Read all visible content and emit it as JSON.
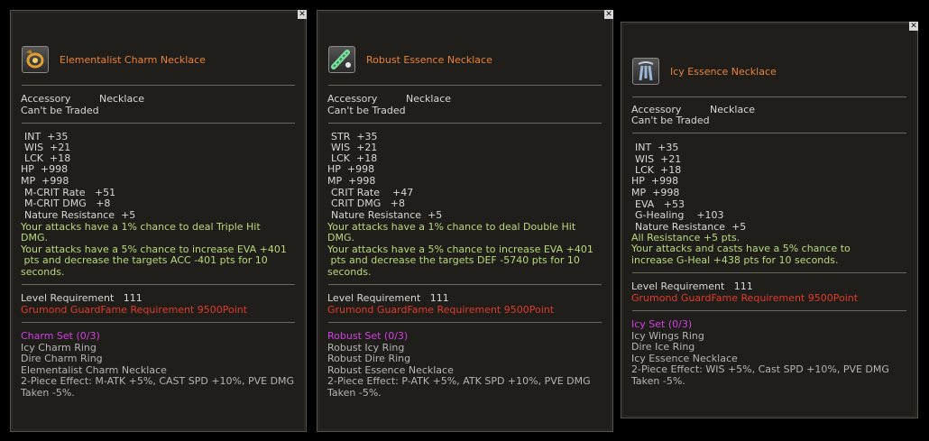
{
  "close_label": "✕",
  "panels": [
    {
      "title": "Elementalist Charm Necklace",
      "icon": "charm-necklace-icon",
      "type_label": "Accessory",
      "type_value": "Necklace",
      "trade": "Can't be Traded",
      "stats": [
        "INT  +35",
        "WIS  +21",
        "LCK  +18",
        "HP  +998",
        "MP  +998",
        "M-CRIT Rate   +51",
        "M-CRIT DMG   +8",
        "Nature Resistance  +5"
      ],
      "effects": [
        "Your attacks have a 1% chance to deal Triple Hit",
        "DMG.",
        "Your attacks have a 5% chance to increase EVA +401",
        " pts and decrease the targets ACC -401 pts for 10",
        "seconds."
      ],
      "level_req": "Level Requirement   111",
      "fame_req": "Grumond GuardFame Requirement 9500Point",
      "set_name": "Charm Set (0/3)",
      "set_items": [
        "Icy Charm Ring",
        "Dire Charm Ring",
        "Elementalist Charm Necklace",
        "2-Piece Effect: M-ATK +5%, CAST SPD +10%, PVE DMG",
        "Taken -5%."
      ]
    },
    {
      "title": "Robust Essence Necklace",
      "icon": "essence-necklace-icon",
      "type_label": "Accessory",
      "type_value": "Necklace",
      "trade": "Can't be Traded",
      "stats": [
        "STR  +35",
        "WIS  +21",
        "LCK  +18",
        "HP  +998",
        "MP  +998",
        "CRIT Rate    +47",
        "CRIT DMG   +8",
        "Nature Resistance  +5"
      ],
      "effects": [
        "Your attacks have a 1% chance to deal Double Hit",
        "DMG.",
        "Your attacks have a 5% chance to increase EVA +401",
        " pts and decrease the targets DEF -5740 pts for 10",
        "seconds."
      ],
      "level_req": "Level Requirement   111",
      "fame_req": "Grumond GuardFame Requirement 9500Point",
      "set_name": "Robust Set (0/3)",
      "set_items": [
        "Robust Icy Ring",
        "Robust Dire Ring",
        "Robust Essence Necklace",
        "2-Piece Effect: P-ATK +5%, ATK SPD +10%, PVE DMG",
        "Taken -5%."
      ]
    },
    {
      "title": "Icy Essence Necklace",
      "icon": "icy-necklace-icon",
      "type_label": "Accessory",
      "type_value": "Necklace",
      "trade": "Can't be Traded",
      "stats": [
        "INT  +35",
        "WIS  +21",
        "LCK  +18",
        "HP  +998",
        "MP  +998",
        "EVA   +53",
        "G-Healing    +103",
        "Nature Resistance  +5"
      ],
      "effects": [
        "All Resistance +5 pts.",
        "Your attacks and casts have a 5% chance to",
        "increase G-Heal +438 pts for 10 seconds."
      ],
      "level_req": "Level Requirement   111",
      "fame_req": "Grumond GuardFame Requirement 9500Point",
      "set_name": "Icy Set (0/3)",
      "set_items": [
        "Icy Wings Ring",
        "Dire Ice Ring",
        "Icy Essence Necklace",
        "2-Piece Effect: WIS +5%, Cast SPD +10%, PVE DMG",
        "Taken -5%."
      ]
    }
  ]
}
